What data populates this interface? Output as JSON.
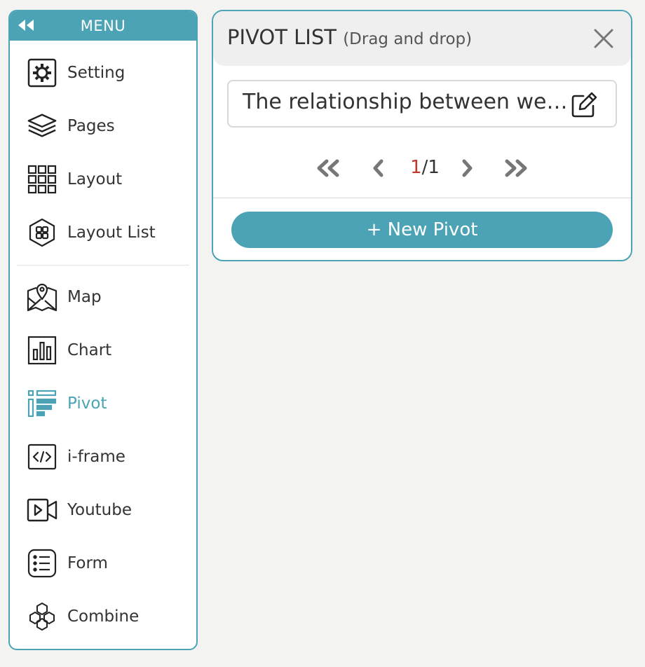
{
  "menu": {
    "title": "MENU",
    "items": [
      {
        "label": "Setting",
        "icon": "gear-icon"
      },
      {
        "label": "Pages",
        "icon": "layers-icon"
      },
      {
        "label": "Layout",
        "icon": "grid-icon"
      },
      {
        "label": "Layout List",
        "icon": "hexagon-grid-icon"
      },
      {
        "label": "Map",
        "icon": "map-pin-icon"
      },
      {
        "label": "Chart",
        "icon": "bar-chart-icon"
      },
      {
        "label": "Pivot",
        "icon": "pivot-icon",
        "active": true
      },
      {
        "label": "i-frame",
        "icon": "code-icon"
      },
      {
        "label": "Youtube",
        "icon": "video-camera-icon"
      },
      {
        "label": "Form",
        "icon": "list-form-icon"
      },
      {
        "label": "Combine",
        "icon": "hexagons-icon"
      }
    ]
  },
  "panel": {
    "title": "PIVOT LIST",
    "subtitle": "(Drag and drop)",
    "item_title": "The relationship between we…",
    "pager": {
      "current": "1",
      "separator": "/",
      "total": "1"
    },
    "new_button": "+ New Pivot"
  },
  "colors": {
    "accent": "#4ba3b5",
    "current_page": "#c0392b",
    "background": "#f3f3f2"
  }
}
